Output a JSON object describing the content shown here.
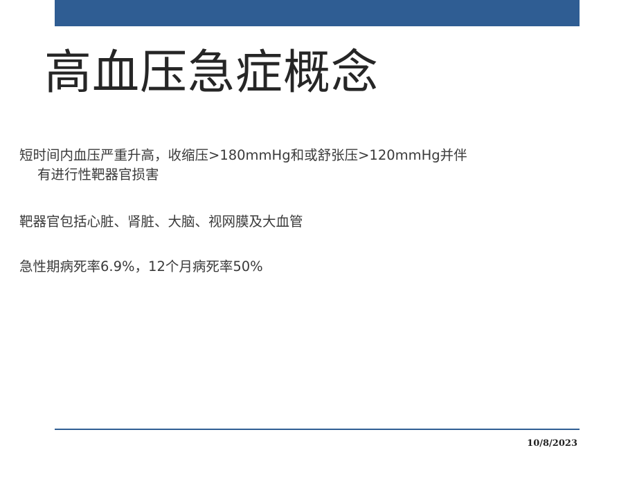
{
  "slide": {
    "title": "高血压急症概念",
    "bullets": [
      {
        "line1": "短时间内血压严重升高，收缩压>180mmHg和或舒张压>120mmHg并伴",
        "line2": "有进行性靶器官损害"
      },
      {
        "line1": "靶器官包括心脏、肾脏、大脑、视网膜及大血管"
      },
      {
        "line1": "急性期病死率6.9%，12个月病死率50%"
      }
    ],
    "footer_date": "10/8/2023"
  },
  "colors": {
    "accent": "#2f5d93",
    "text": "#262626"
  }
}
